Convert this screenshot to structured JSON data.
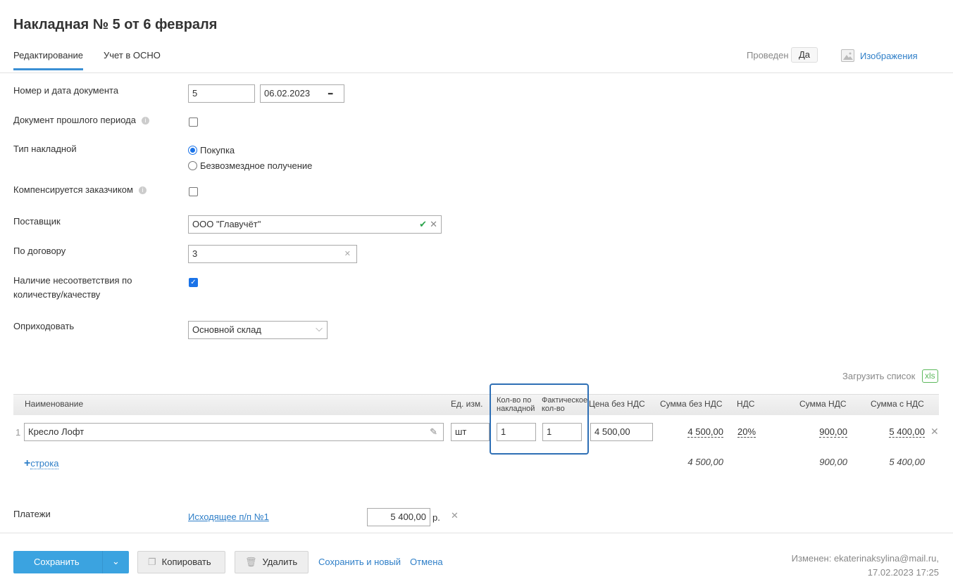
{
  "title": "Накладная № 5 от 6 февраля",
  "tabs": [
    "Редактирование",
    "Учет в ОСНО"
  ],
  "status": {
    "label": "Проведен",
    "value": "Да"
  },
  "images_link": "Изображения",
  "form": {
    "doc_label": "Номер и дата документа",
    "doc_number": "5",
    "doc_date": "06.02.2023",
    "past_period_label": "Документ прошлого периода",
    "type_label": "Тип накладной",
    "type_options": [
      "Покупка",
      "Безвозмездное получение"
    ],
    "compensated_label": "Компенсируется заказчиком",
    "supplier_label": "Поставщик",
    "supplier": "ООО \"Главучёт\"",
    "contract_label": "По договору",
    "contract": "3",
    "mismatch_label": "Наличие несоответствия по количеству/качеству",
    "receive_label": "Оприходовать",
    "warehouse": "Основной склад"
  },
  "upload_list": "Загрузить список",
  "xls": "xls",
  "table": {
    "headers": [
      "Наименование",
      "Ед. изм.",
      "Кол-во по накладной",
      "Фактическое кол-во",
      "Цена без НДС",
      "Сумма без НДС",
      "НДС",
      "Сумма НДС",
      "Сумма с НДС"
    ],
    "rows": [
      {
        "num": "1",
        "name": "Кресло Лофт",
        "unit": "шт",
        "qty_invoice": "1",
        "qty_actual": "1",
        "price": "4 500,00",
        "sum": "4 500,00",
        "vat": "20%",
        "vat_sum": "900,00",
        "total": "5 400,00"
      }
    ],
    "add_row": "строка",
    "totals": {
      "sum": "4 500,00",
      "vat_sum": "900,00",
      "total": "5 400,00"
    }
  },
  "payments": {
    "label": "Платежи",
    "link": "Исходящее п/п №1",
    "amount": "5 400,00",
    "currency": "р."
  },
  "footer": {
    "save": "Сохранить",
    "copy": "Копировать",
    "delete": "Удалить",
    "save_new": "Сохранить и новый",
    "cancel": "Отмена",
    "modified": "Изменен: ekaterinaksylina@mail.ru,",
    "modified_date": "17.02.2023 17:25"
  }
}
